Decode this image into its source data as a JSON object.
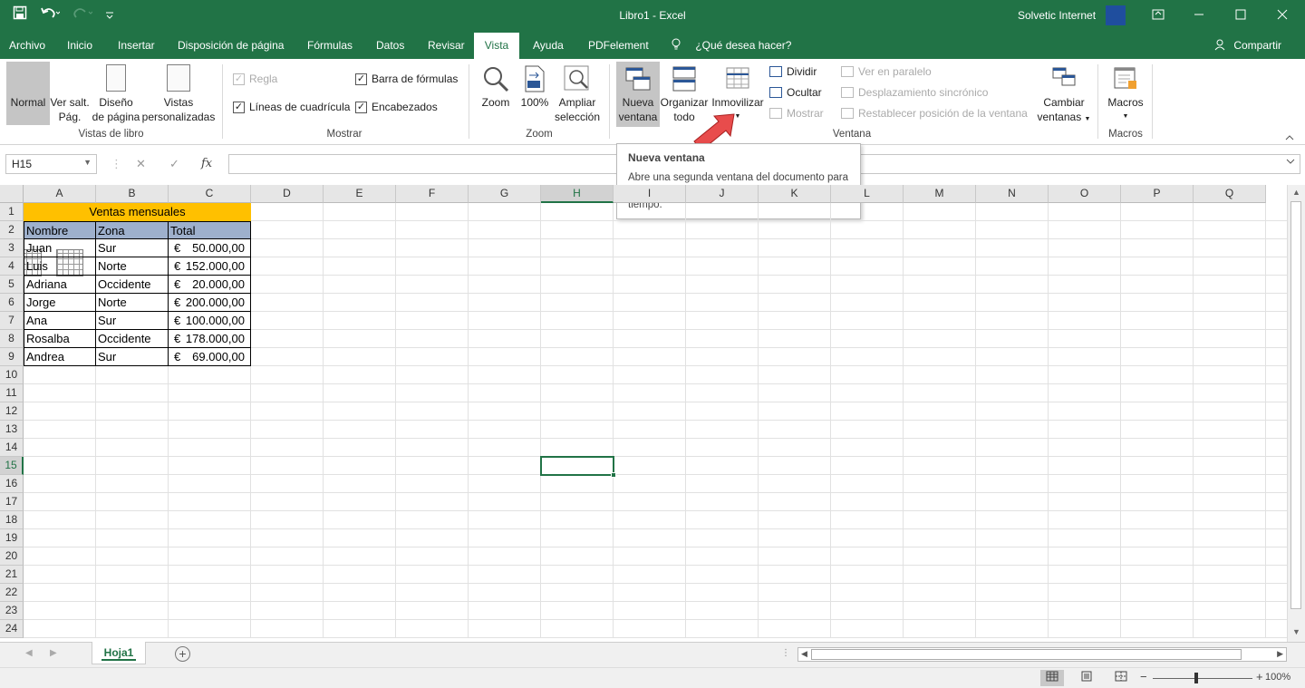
{
  "titlebar": {
    "title": "Libro1 - Excel",
    "user": "Solvetic Internet",
    "icons": [
      "save-icon",
      "undo-icon",
      "redo-icon",
      "customize-qat-icon",
      "ribbon-display-icon",
      "minimize-icon",
      "maximize-icon",
      "close-icon"
    ]
  },
  "tabs": {
    "items": [
      "Archivo",
      "Inicio",
      "Insertar",
      "Disposición de página",
      "Fórmulas",
      "Datos",
      "Revisar",
      "Vista",
      "Ayuda",
      "PDFelement"
    ],
    "active": "Vista",
    "tellme": "¿Qué desea hacer?",
    "share": "Compartir"
  },
  "ribbon": {
    "workbook_views": {
      "group": "Vistas de libro",
      "normal": "Normal",
      "pagebreak_1": "Ver salt.",
      "pagebreak_2": "Pág.",
      "pagelayout_1": "Diseño",
      "pagelayout_2": "de página",
      "custom_1": "Vistas",
      "custom_2": "personalizadas"
    },
    "show": {
      "group": "Mostrar",
      "ruler": "Regla",
      "gridlines": "Líneas de cuadrícula",
      "formula_bar": "Barra de fórmulas",
      "headings": "Encabezados"
    },
    "zoom": {
      "group": "Zoom",
      "zoom": "Zoom",
      "hundred": "100%",
      "selection_1": "Ampliar",
      "selection_2": "selección"
    },
    "window": {
      "group": "Ventana",
      "new_1": "Nueva",
      "new_2": "ventana",
      "arrange_1": "Organizar",
      "arrange_2": "todo",
      "freeze": "Inmovilizar",
      "split": "Dividir",
      "hide": "Ocultar",
      "unhide": "Mostrar",
      "side_by_side": "Ver en paralelo",
      "sync_scroll": "Desplazamiento sincrónico",
      "reset_position": "Restablecer posición de la ventana",
      "switch_1": "Cambiar",
      "switch_2": "ventanas"
    },
    "macros": {
      "group": "Macros",
      "macros": "Macros"
    }
  },
  "formula_bar": {
    "name_box": "H15",
    "cancel": "✕",
    "enter": "✓",
    "fx": "fx",
    "content": ""
  },
  "tooltip": {
    "title": "Nueva ventana",
    "body": "Abre una segunda ventana del documento para que pueda trabajar en distintos sitios al mismo tiempo."
  },
  "sheet": {
    "columns": [
      "A",
      "B",
      "C",
      "D",
      "E",
      "F",
      "G",
      "H",
      "I",
      "J",
      "K",
      "L",
      "M",
      "N",
      "O",
      "P",
      "Q"
    ],
    "selected_column": "H",
    "rows": [
      "1",
      "2",
      "3",
      "4",
      "5",
      "6",
      "7",
      "8",
      "9",
      "10",
      "11",
      "12",
      "13",
      "14",
      "15",
      "16",
      "17",
      "18",
      "19",
      "20",
      "21",
      "22",
      "23",
      "24"
    ],
    "selected_row": "15",
    "title": "Ventas mensuales",
    "headers": [
      "Nombre",
      "Zona",
      "Total"
    ],
    "data": [
      {
        "name": "Juan",
        "zone": "Sur",
        "currency": "€",
        "total": "50.000,00"
      },
      {
        "name": "Luis",
        "zone": "Norte",
        "currency": "€",
        "total": "152.000,00"
      },
      {
        "name": "Adriana",
        "zone": "Occidente",
        "currency": "€",
        "total": "20.000,00"
      },
      {
        "name": "Jorge",
        "zone": "Norte",
        "currency": "€",
        "total": "200.000,00"
      },
      {
        "name": "Ana",
        "zone": "Sur",
        "currency": "€",
        "total": "100.000,00"
      },
      {
        "name": "Rosalba",
        "zone": "Occidente",
        "currency": "€",
        "total": "178.000,00"
      },
      {
        "name": "Andrea",
        "zone": "Sur",
        "currency": "€",
        "total": "69.000,00"
      }
    ]
  },
  "sheet_tabs": {
    "active": "Hoja1",
    "add": "+"
  },
  "statusbar": {
    "zoom_percent": "100%",
    "minus": "−",
    "plus": "+"
  },
  "colors": {
    "accent": "#217346",
    "title_fill": "#ffc000",
    "header_fill": "#9eb0cc",
    "arrow": "#e84c4c"
  }
}
